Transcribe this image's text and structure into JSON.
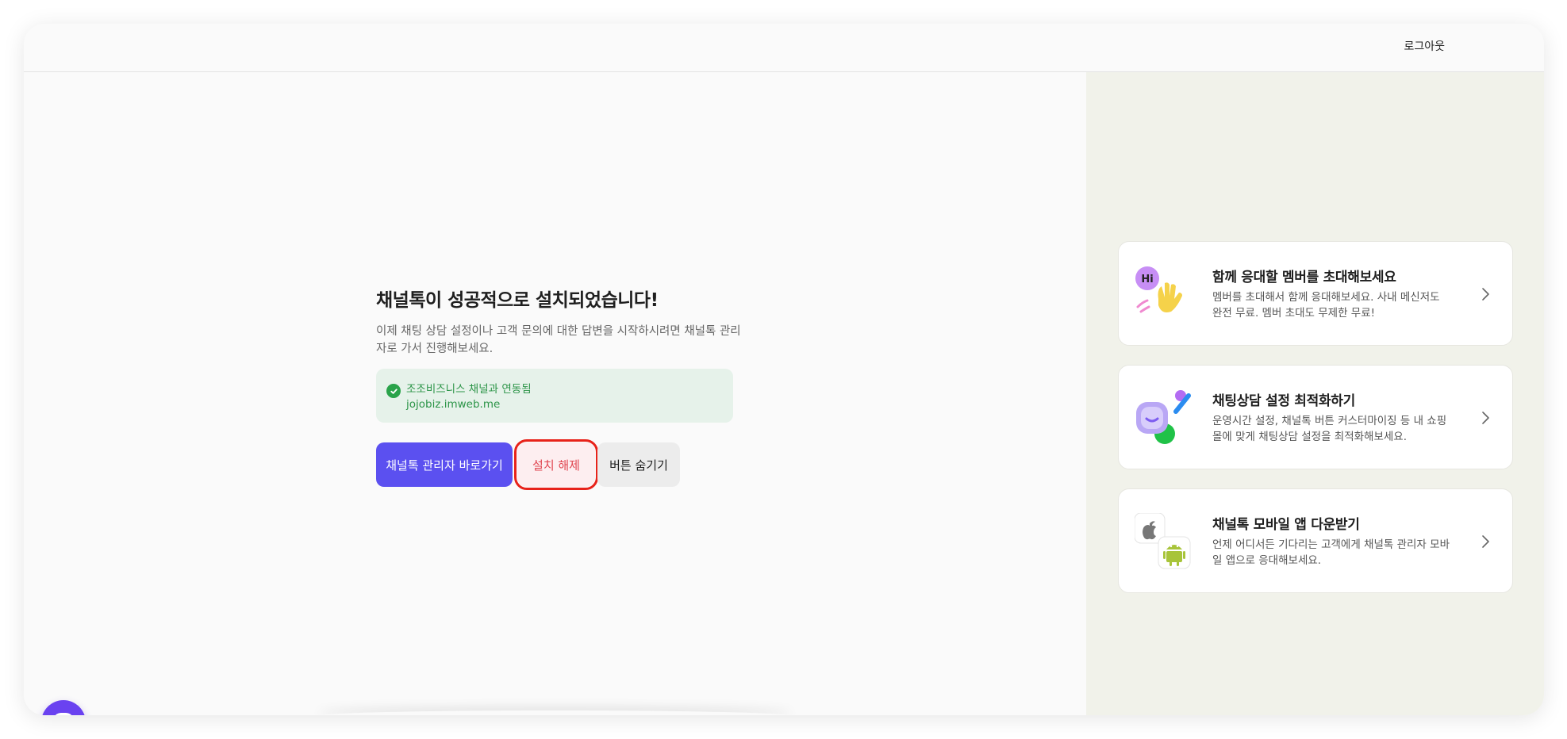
{
  "header": {
    "logout_label": "로그아웃"
  },
  "main": {
    "title": "채널톡이 성공적으로 설치되었습니다!",
    "description": "이제 채팅 상담 설정이나 고객 문의에 대한 답변을 시작하시려면 채널톡 관리자로 가서 진행해보세요.",
    "status": {
      "line1": "조조비즈니스 채널과 연동됨",
      "line2": "jojobiz.imweb.me"
    },
    "buttons": {
      "primary_label": "채널톡 관리자 바로가기",
      "uninstall_label": "설치 해제",
      "hide_label": "버튼 숨기기"
    }
  },
  "cards": [
    {
      "title": "함께 응대할 멤버를 초대해보세요",
      "desc": "멤버를 초대해서 함께 응대해보세요. 사내 메신저도 완전 무료. 멤버 초대도 무제한 무료!",
      "icon_text": "Hi"
    },
    {
      "title": "채팅상담 설정 최적화하기",
      "desc": "운영시간 설정, 채널톡 버튼 커스터마이징 등 내 쇼핑몰에 맞게 채팅상담 설정을 최적화해보세요."
    },
    {
      "title": "채널톡 모바일 앱 다운받기",
      "desc": "언제 어디서든 기다리는 고객에게 채널톡 관리자 모바일 앱으로 응대해보세요."
    }
  ],
  "colors": {
    "primary": "#5b50f0",
    "uninstall_text": "#e0454f",
    "highlight": "#e8221a",
    "success": "#2b9447",
    "right_panel": "#f1f2ea"
  },
  "icons": [
    "check-circle-icon",
    "hi-wave-icon",
    "chat-settings-icon",
    "apple-icon",
    "android-icon",
    "chevron-right-icon",
    "channel-chat-icon"
  ]
}
